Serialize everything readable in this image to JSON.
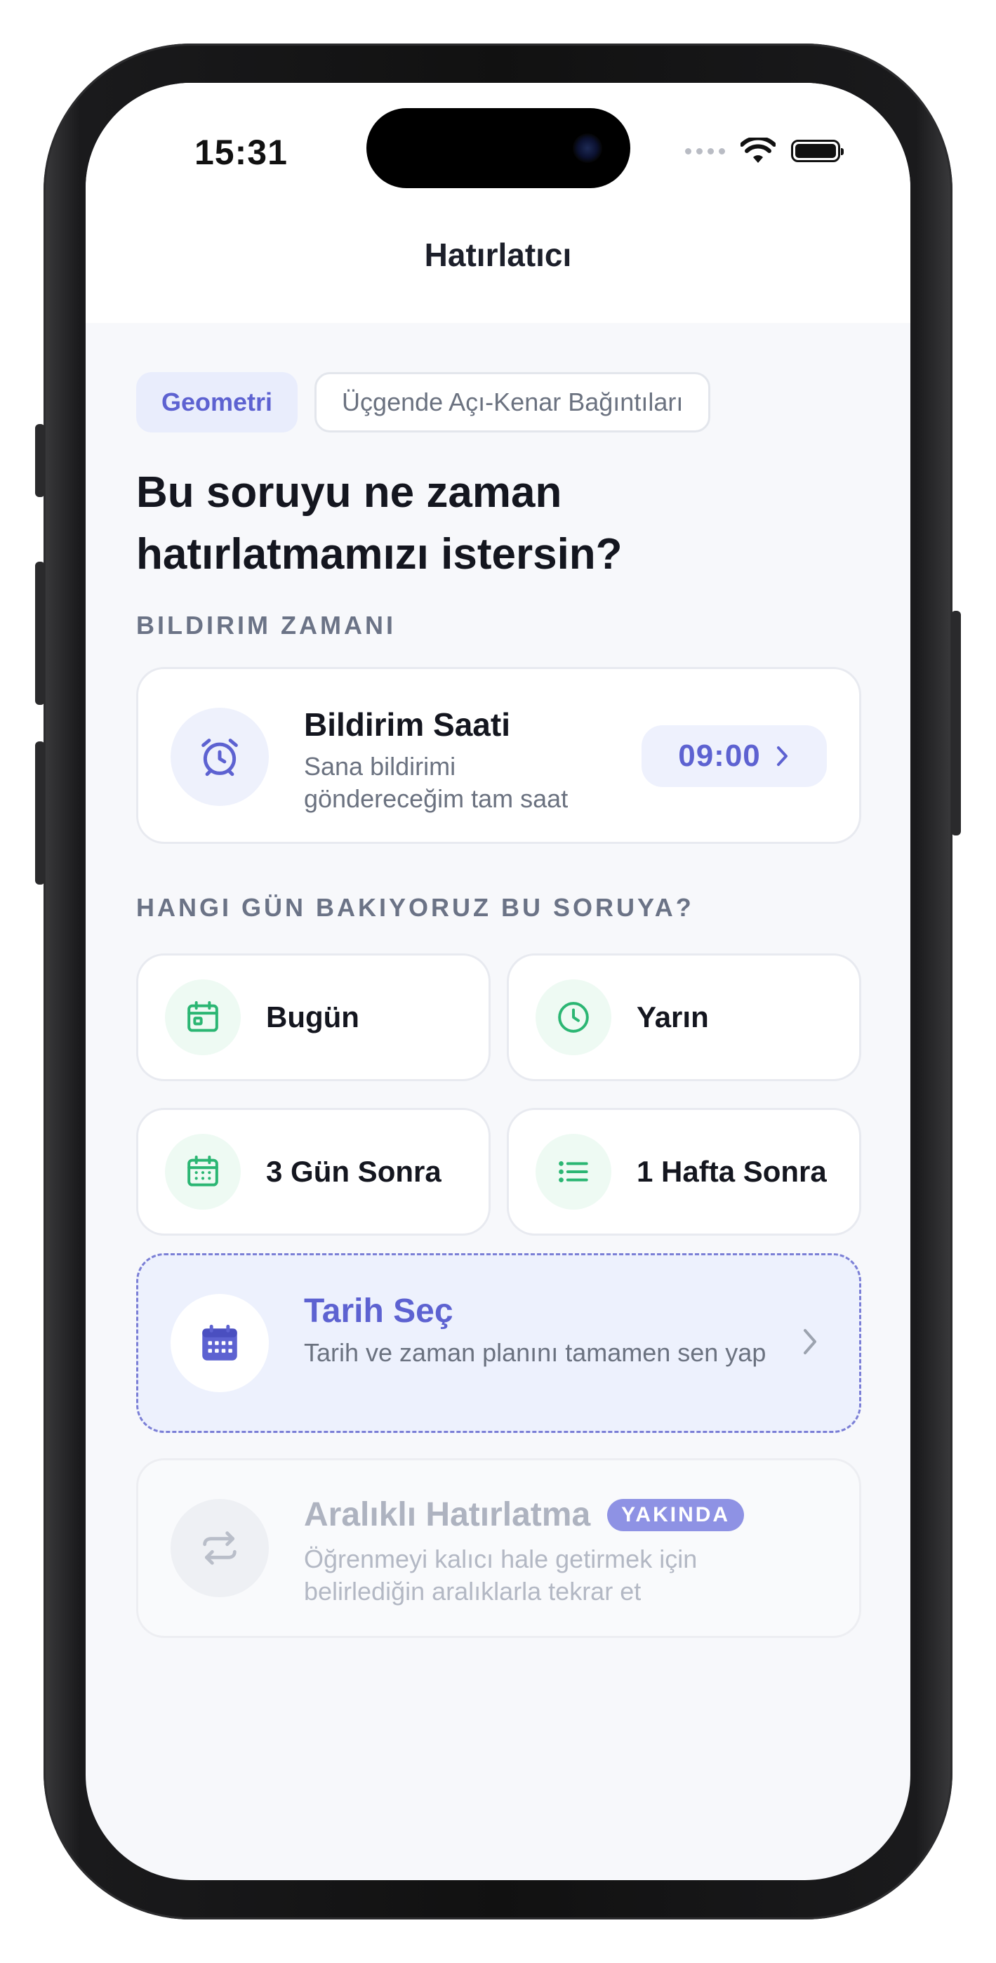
{
  "status_bar": {
    "time": "15:31"
  },
  "nav": {
    "title": "Hatırlatıcı"
  },
  "chips": {
    "subject": "Geometri",
    "topic": "Üçgende Açı-Kenar Bağıntıları"
  },
  "headline": {
    "line1": "Bu soruyu ne zaman",
    "line2": "hatırlatmamızı istersin?"
  },
  "notification": {
    "section_label": "BILDIRIM ZAMANI",
    "title": "Bildirim Saati",
    "subtitle": "Sana bildirimi göndereceğim tam saat",
    "time": "09:00",
    "icon": "alarm-clock-icon"
  },
  "days": {
    "section_label": "HANGI GÜN BAKIYORUZ BU SORUYA?",
    "options": [
      {
        "label": "Bugün",
        "icon": "calendar-today-icon"
      },
      {
        "label": "Yarın",
        "icon": "clock-icon"
      },
      {
        "label": "3 Gün Sonra",
        "icon": "calendar-grid-icon"
      },
      {
        "label": "1 Hafta Sonra",
        "icon": "list-icon"
      }
    ]
  },
  "pick_date": {
    "title": "Tarih Seç",
    "subtitle": "Tarih ve zaman planını tamamen sen yap",
    "icon": "calendar-icon"
  },
  "spaced": {
    "title": "Aralıklı Hatırlatma",
    "badge": "YAKINDA",
    "subtitle": "Öğrenmeyi kalıcı hale getirmek için belirlediğin aralıklarla tekrar et",
    "icon": "repeat-icon"
  },
  "colors": {
    "accent": "#5d62d1",
    "accent_soft": "#eef1fd",
    "green": "#2bb673",
    "background": "#f7f8fb"
  }
}
